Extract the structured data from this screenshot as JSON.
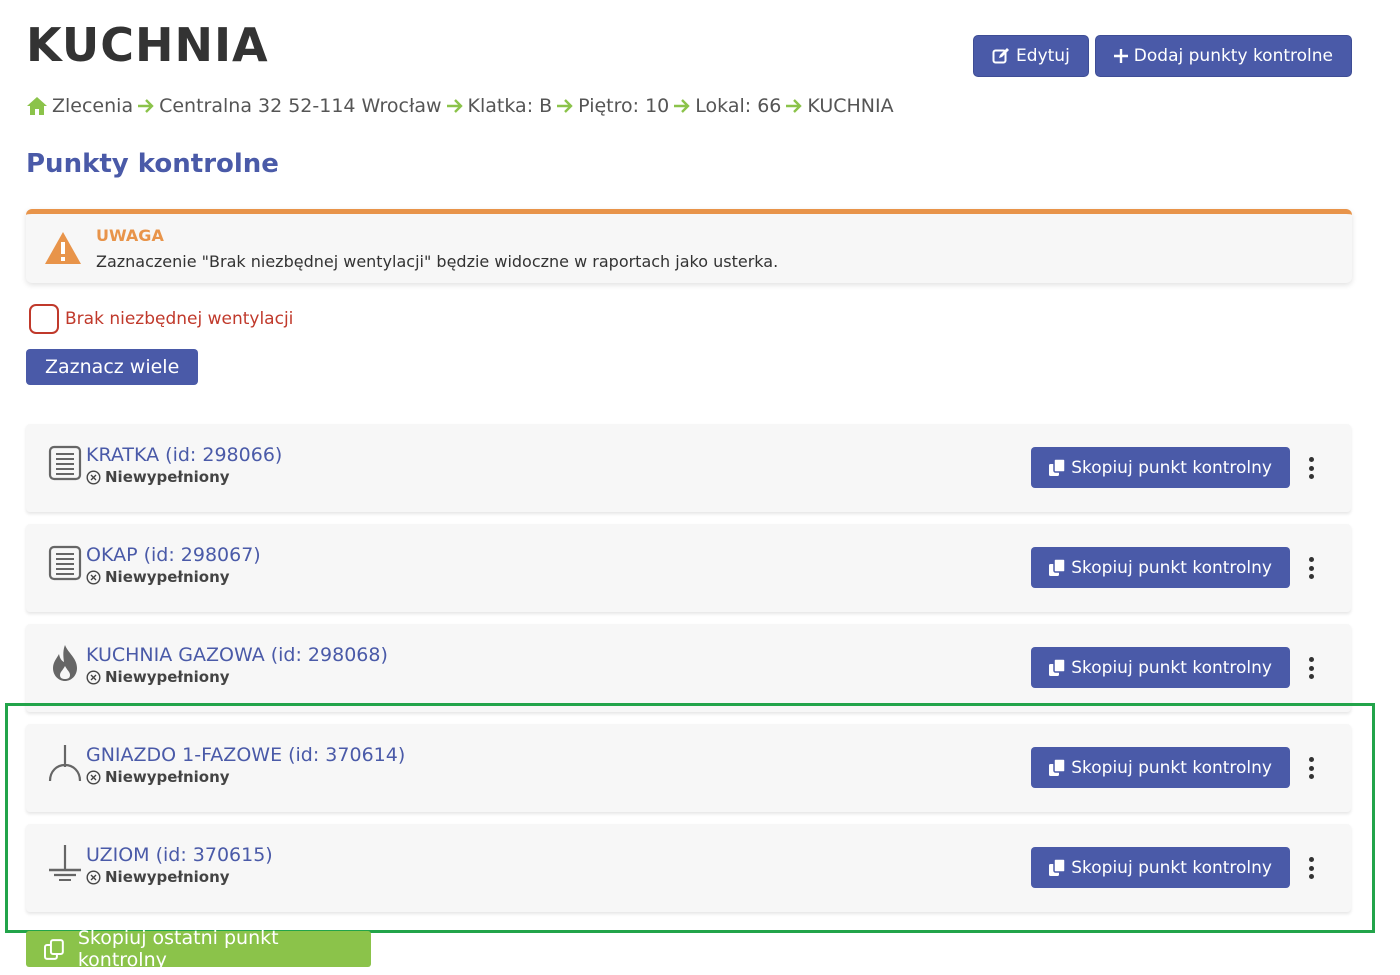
{
  "header": {
    "title": "KUCHNIA",
    "edit_label": "Edytuj",
    "add_label": "Dodaj punkty kontrolne"
  },
  "breadcrumb": [
    "Zlecenia",
    "Centralna 32 52-114 Wrocław",
    "Klatka: B",
    "Piętro: 10",
    "Lokal: 66",
    "KUCHNIA"
  ],
  "section_title": "Punkty kontrolne",
  "alert": {
    "heading": "UWAGA",
    "text": "Zaznaczenie \"Brak niezbędnej wentylacji\" będzie widoczne w raportach jako usterka."
  },
  "ventilation_checkbox_label": "Brak niezbędnej wentylacji",
  "select_many_label": "Zaznacz wiele",
  "control_points": [
    {
      "name": "KRATKA (id: 298066)",
      "status": "Niewypełniony",
      "icon": "grate-icon",
      "copy_label": "Skopiuj punkt kontrolny"
    },
    {
      "name": "OKAP (id: 298067)",
      "status": "Niewypełniony",
      "icon": "grate-icon",
      "copy_label": "Skopiuj punkt kontrolny"
    },
    {
      "name": "KUCHNIA GAZOWA (id: 298068)",
      "status": "Niewypełniony",
      "icon": "flame-icon",
      "copy_label": "Skopiuj punkt kontrolny"
    },
    {
      "name": "GNIAZDO 1-FAZOWE (id: 370614)",
      "status": "Niewypełniony",
      "icon": "socket-icon",
      "copy_label": "Skopiuj punkt kontrolny"
    },
    {
      "name": "UZIOM (id: 370615)",
      "status": "Niewypełniony",
      "icon": "ground-icon",
      "copy_label": "Skopiuj punkt kontrolny"
    }
  ],
  "copy_last_label": "Skopiuj ostatni punkt kontrolny",
  "colors": {
    "primary": "#4a5aa8",
    "warning": "#e8944a",
    "danger": "#c0392b",
    "success": "#8bc34a",
    "breadcrumb_arrow": "#8bc34a",
    "highlight": "#22a44a"
  }
}
